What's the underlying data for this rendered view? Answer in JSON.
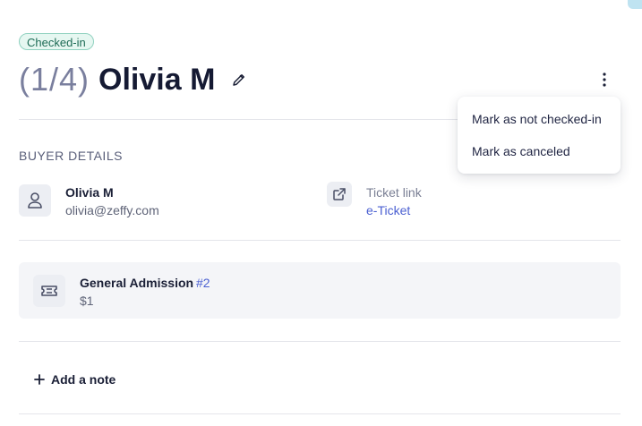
{
  "status_badge": "Checked-in",
  "header": {
    "index": "(1/4)",
    "name": "Olivia M"
  },
  "buyer_section": {
    "title": "BUYER DETAILS",
    "name": "Olivia M",
    "email": "olivia@zeffy.com",
    "ticket_link_label": "Ticket link",
    "ticket_link_text": "e-Ticket"
  },
  "ticket": {
    "name": "General Admission",
    "number": "#2",
    "price": "$1"
  },
  "add_note_label": "Add a note",
  "menu": {
    "items": [
      "Mark as not checked-in",
      "Mark as canceled"
    ]
  },
  "icons": {
    "edit": "pencil-icon",
    "more": "more-vertical-icon",
    "user": "user-icon",
    "external": "external-link-icon",
    "ticket": "ticket-icon",
    "plus": "plus-icon"
  },
  "colors": {
    "accent": "#4a5fd1",
    "badge_bg": "#e6f7f1",
    "badge_border": "#8fd1bf"
  }
}
